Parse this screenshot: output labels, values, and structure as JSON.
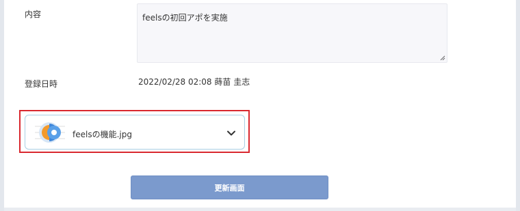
{
  "form": {
    "content_label": "内容",
    "content_value": "feelsの初回アポを実施",
    "registered_label": "登録日時",
    "registered_value": "2022/02/28 02:08 蒔苗 圭志"
  },
  "attachment": {
    "file_name": "feelsの機能.jpg",
    "thumbnail_icon": "image-thumbnail-icon",
    "expand_icon": "chevron-down-icon"
  },
  "actions": {
    "update_label": "更新画面"
  },
  "colors": {
    "highlight_border": "#d9272e",
    "card_border": "#a9cfe4",
    "button_bg": "#7b9acd"
  }
}
